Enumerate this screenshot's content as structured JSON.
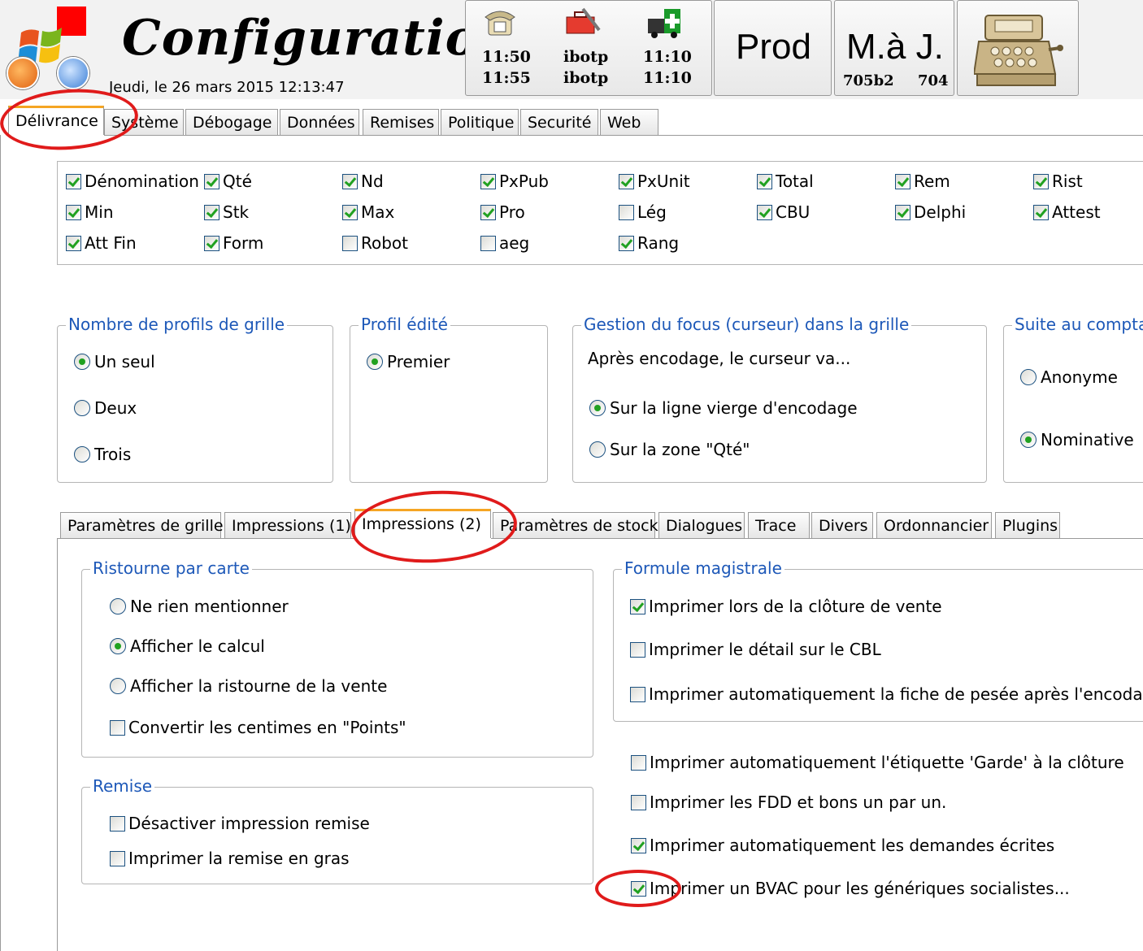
{
  "header": {
    "title": "Configuration",
    "date": "Jeudi, le 26 mars 2015  12:13:47",
    "phone": {
      "r1": [
        "11:50",
        "ibotp",
        "11:10"
      ],
      "r2": [
        "11:55",
        "ibotp",
        "11:10"
      ]
    },
    "prod_label": "Prod",
    "update": {
      "label": "M.à J.",
      "version": "705b2",
      "number": "704"
    }
  },
  "main_tabs": [
    "Délivrance",
    "Système",
    "Débogage",
    "Données",
    "Remises",
    "Politique",
    "Securité",
    "Web"
  ],
  "columns": [
    {
      "label": "Dénomination",
      "checked": true
    },
    {
      "label": "Qté",
      "checked": true
    },
    {
      "label": "Nd",
      "checked": true
    },
    {
      "label": "PxPub",
      "checked": true
    },
    {
      "label": "PxUnit",
      "checked": true
    },
    {
      "label": "Total",
      "checked": true
    },
    {
      "label": "Rem",
      "checked": true
    },
    {
      "label": "Rist",
      "checked": true
    },
    {
      "label": "Min",
      "checked": true
    },
    {
      "label": "Stk",
      "checked": true
    },
    {
      "label": "Max",
      "checked": true
    },
    {
      "label": "Pro",
      "checked": true
    },
    {
      "label": "Lég",
      "checked": false
    },
    {
      "label": "CBU",
      "checked": true
    },
    {
      "label": "Delphi",
      "checked": true
    },
    {
      "label": "Attest",
      "checked": true
    },
    {
      "label": "Att Fin",
      "checked": true
    },
    {
      "label": "Form",
      "checked": true
    },
    {
      "label": "Robot",
      "checked": false
    },
    {
      "label": "aeg",
      "checked": false
    },
    {
      "label": "Rang",
      "checked": true
    }
  ],
  "profiles": {
    "title": "Nombre de profils de grille",
    "options": [
      "Un seul",
      "Deux",
      "Trois"
    ],
    "selected": 0
  },
  "edited": {
    "title": "Profil édité",
    "options": [
      "Premier"
    ],
    "selected": 0
  },
  "focus": {
    "title": "Gestion du focus (curseur) dans la grille",
    "intro": "Après encodage, le curseur va...",
    "options": [
      "Sur la ligne vierge d'encodage",
      "Sur la zone \"Qté\""
    ],
    "selected": 0
  },
  "suite": {
    "title": "Suite au comptan",
    "options": [
      "Anonyme",
      "Nominative"
    ],
    "selected": 1
  },
  "sub_tabs": [
    "Paramètres de grille",
    "Impressions (1)",
    "Impressions (2)",
    "Paramètres de stock",
    "Dialogues",
    "Trace",
    "Divers",
    "Ordonnancier",
    "Plugins"
  ],
  "ristourne": {
    "title": "Ristourne par carte",
    "options": [
      "Ne rien mentionner",
      "Afficher le calcul",
      "Afficher la ristourne de la vente"
    ],
    "selected": 1,
    "convert": {
      "label": "Convertir les centimes en \"Points\"",
      "checked": false
    }
  },
  "remise": {
    "title": "Remise",
    "items": [
      {
        "label": "Désactiver impression remise",
        "checked": false
      },
      {
        "label": "Imprimer la remise en gras",
        "checked": false
      }
    ]
  },
  "formule": {
    "title": "Formule magistrale",
    "items": [
      {
        "label": "Imprimer lors de la clôture de vente",
        "checked": true
      },
      {
        "label": "Imprimer le détail sur le CBL",
        "checked": false
      },
      {
        "label": "Imprimer automatiquement la fiche de pesée après l'encodage.",
        "checked": false
      }
    ]
  },
  "extra": [
    {
      "label": "Imprimer automatiquement l'étiquette 'Garde' à la clôture",
      "checked": false
    },
    {
      "label": "Imprimer les FDD et bons un par un.",
      "checked": false
    },
    {
      "label": "Imprimer automatiquement les demandes écrites",
      "checked": true
    },
    {
      "label": "Imprimer un BVAC pour les génériques socialistes...",
      "checked": true
    }
  ],
  "colors": {
    "accent_tab": "#f5a523",
    "legend": "#1d58b8",
    "check": "#21a121",
    "annotation": "#e01b1b"
  }
}
